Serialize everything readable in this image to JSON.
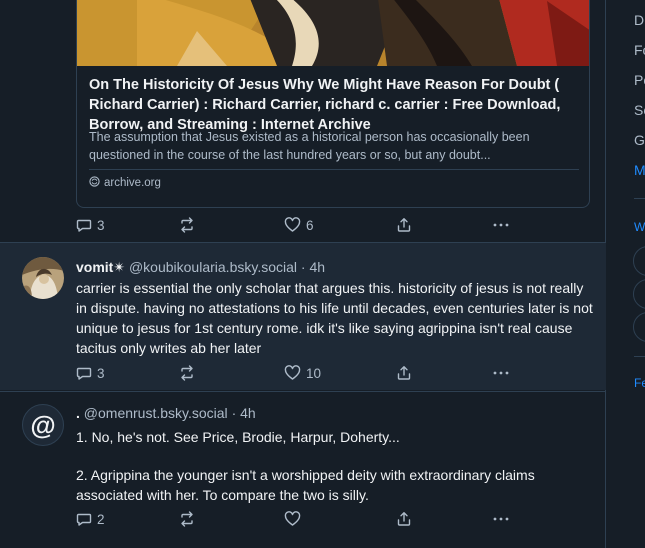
{
  "post1": {
    "card": {
      "title": "On The Historicity Of Jesus Why We Might Have Reason For Doubt ( Richard Carrier) : Richard Carrier, richard c. carrier : Free Download, Borrow, and Streaming : Internet Archive",
      "description": "The assumption that Jesus existed as a historical person has occasionally been questioned in the course of the last hundred years or so, but any doubt...",
      "domain": "archive.org"
    },
    "actions": {
      "replies": "3",
      "likes": "6"
    }
  },
  "post2": {
    "display_name": "vomit✴",
    "handle": "@koubikoularia.bsky.social",
    "time": "· 4h",
    "text": "carrier is essential the only scholar that argues this. historicity of jesus is not really in dispute. having no attestations to his life until decades, even centuries later is not unique to jesus for 1st century rome. idk it's like saying agrippina isn't real cause tacitus only writes ab her later",
    "actions": {
      "replies": "3",
      "likes": "10"
    }
  },
  "post3": {
    "display_name": ".",
    "handle": "@omenrust.bsky.social",
    "time": "· 4h",
    "paragraph1": "1. No, he's not. See Price, Brodie, Harpur, Doherty...",
    "paragraph2": "2. Agrippina the younger isn't a worshipped deity with extraordinary claims associated with her. To compare the two is silly.",
    "avatar_glyph": "@",
    "actions": {
      "replies": "2",
      "likes": ""
    }
  },
  "sidebar": {
    "links": [
      "D",
      "Fo",
      "Po",
      "Sc",
      "G"
    ],
    "more": "M",
    "section": "W",
    "footer": "Fe"
  },
  "colors": {
    "background": "#161e27",
    "highlight_row": "#1e2936",
    "border": "#2e4052",
    "text_primary": "#f1f3f5",
    "text_secondary": "#aebbc9",
    "accent": "#208bfe"
  }
}
